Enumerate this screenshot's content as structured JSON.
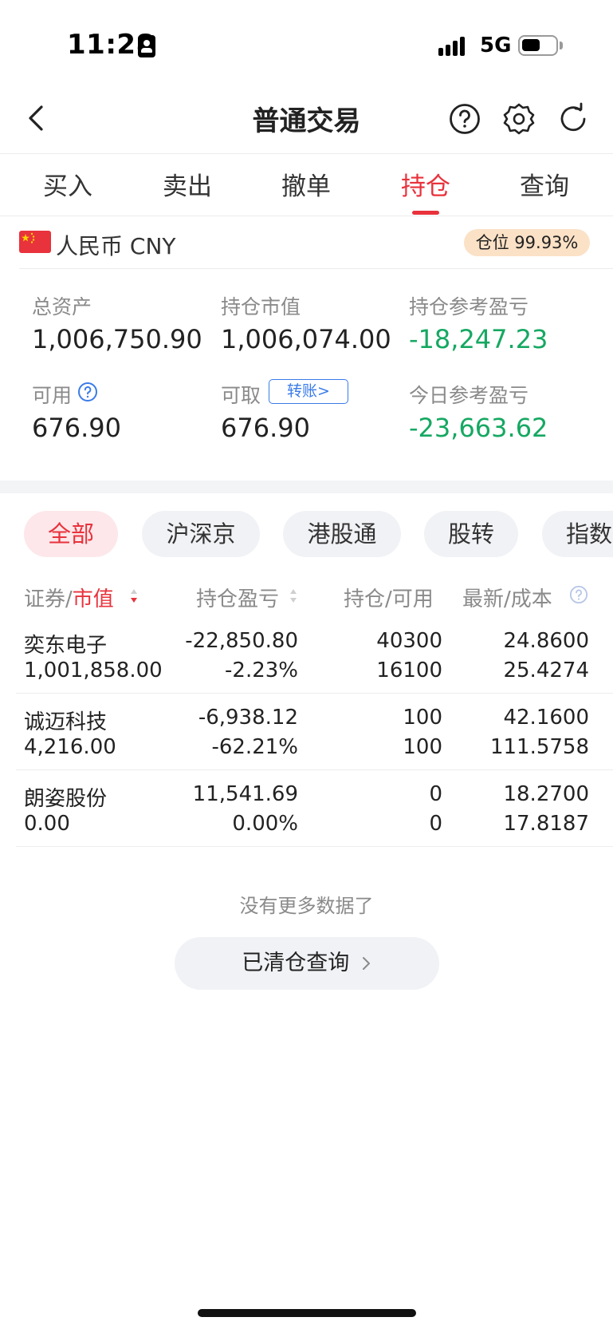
{
  "status_bar": {
    "time": "11:28",
    "network": "5G",
    "battery_level": 0.55
  },
  "header": {
    "title": "普通交易"
  },
  "tabs": [
    {
      "label": "买入",
      "active": false
    },
    {
      "label": "卖出",
      "active": false
    },
    {
      "label": "撤单",
      "active": false
    },
    {
      "label": "持仓",
      "active": true
    },
    {
      "label": "查询",
      "active": false
    }
  ],
  "account": {
    "currency": "人民币 CNY",
    "position_ratio": "仓位 99.93%",
    "summary": {
      "total_assets_label": "总资产",
      "total_assets": "1,006,750.90",
      "market_value_label": "持仓市值",
      "market_value": "1,006,074.00",
      "position_pnl_label": "持仓参考盈亏",
      "position_pnl": "-18,247.23",
      "available_label": "可用",
      "available": "676.90",
      "withdrawable_label": "可取",
      "withdrawable": "676.90",
      "transfer_label": "转账>",
      "today_pnl_label": "今日参考盈亏",
      "today_pnl": "-23,663.62"
    }
  },
  "filters": [
    {
      "label": "全部",
      "active": true
    },
    {
      "label": "沪深京",
      "active": false
    },
    {
      "label": "港股通",
      "active": false
    },
    {
      "label": "股转",
      "active": false
    },
    {
      "label": "指数",
      "active": false
    }
  ],
  "table": {
    "col_security": "证券",
    "col_sep": "/",
    "col_market_value": "市值",
    "col_pnl": "持仓盈亏",
    "col_holding": "持仓",
    "col_available": "可用",
    "col_latest": "最新",
    "col_cost": "成本",
    "rows": [
      {
        "name": "奕东电子",
        "market_value": "1,001,858.00",
        "pnl": "-22,850.80",
        "pnl_pct": "-2.23%",
        "holding": "40300",
        "available": "16100",
        "latest": "24.8600",
        "cost": "25.4274",
        "trend": "down"
      },
      {
        "name": "诚迈科技",
        "market_value": "4,216.00",
        "pnl": "-6,938.12",
        "pnl_pct": "-62.21%",
        "holding": "100",
        "available": "100",
        "latest": "42.1600",
        "cost": "111.5758",
        "trend": "down"
      },
      {
        "name": "朗姿股份",
        "market_value": "0.00",
        "pnl": "11,541.69",
        "pnl_pct": "0.00%",
        "holding": "0",
        "available": "0",
        "latest": "18.2700",
        "cost": "17.8187",
        "trend": "up"
      }
    ]
  },
  "footer": {
    "no_more": "没有更多数据了",
    "cleared_query": "已清仓查询"
  },
  "colors": {
    "accent": "#e8323c",
    "loss": "#16a862",
    "link": "#3a7be8"
  }
}
